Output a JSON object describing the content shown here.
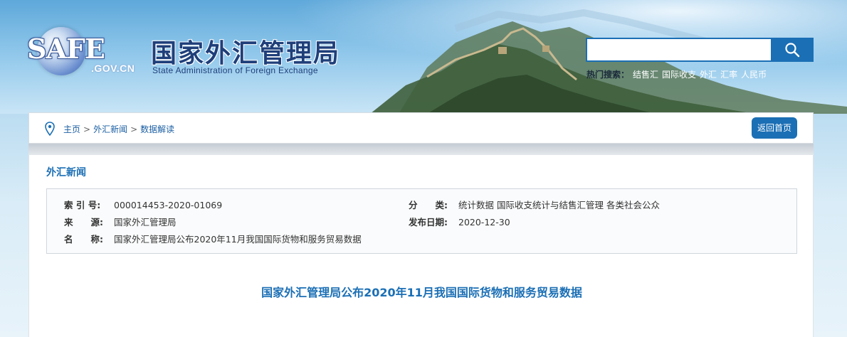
{
  "header": {
    "logo_text": "SAFE",
    "logo_domain": ".GOV.CN",
    "title": "国家外汇管理局",
    "subtitle": "State Administration of Foreign Exchange"
  },
  "search": {
    "placeholder": "",
    "hot_label": "热门搜索：",
    "hot_items": [
      "结售汇",
      "国际收支",
      "外汇",
      "汇率",
      "人民币"
    ]
  },
  "breadcrumb": {
    "items": [
      "主页",
      "外汇新闻",
      "数据解读"
    ],
    "separator": ">",
    "back_label": "返回首页"
  },
  "section": {
    "title": "外汇新闻"
  },
  "meta": {
    "index_label": "索 引 号:",
    "index_value": "000014453-2020-01069",
    "source_label": "来　　源:",
    "source_value": "国家外汇管理局",
    "name_label": "名　　称:",
    "name_value": "国家外汇管理局公布2020年11月我国国际货物和服务贸易数据",
    "category_label": "分　　类:",
    "category_value": "统计数据  国际收支统计与结售汇管理  各类社会公众",
    "date_label": "发布日期:",
    "date_value": "2020-12-30"
  },
  "article": {
    "title": "国家外汇管理局公布2020年11月我国国际货物和服务贸易数据"
  },
  "colors": {
    "accent": "#1b6fb5",
    "title_dark": "#1f3f7a"
  }
}
